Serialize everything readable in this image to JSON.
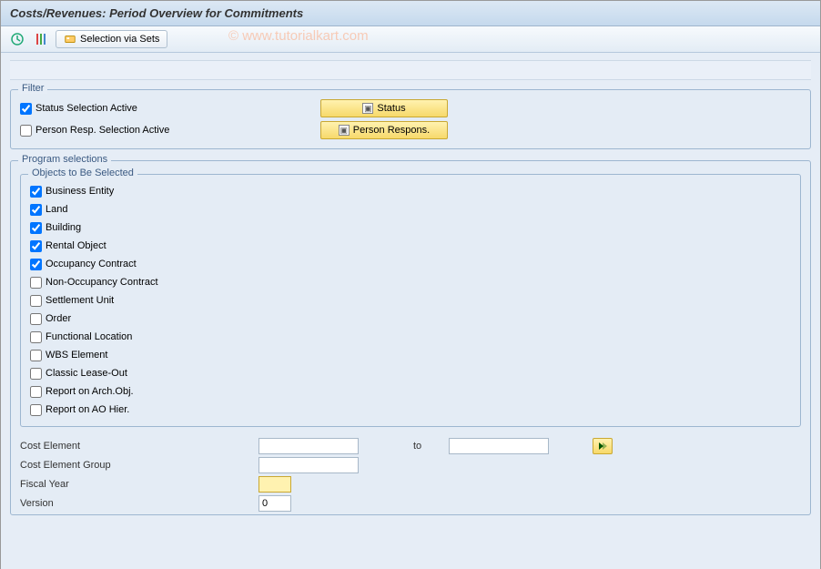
{
  "title": "Costs/Revenues: Period Overview for Commitments",
  "watermark": "© www.tutorialkart.com",
  "toolbar": {
    "selection_via_sets": "Selection via Sets"
  },
  "filter": {
    "group_label": "Filter",
    "status_active_label": "Status Selection Active",
    "status_active_checked": true,
    "status_button": "Status",
    "person_active_label": "Person Resp. Selection Active",
    "person_active_checked": false,
    "person_button": "Person Respons."
  },
  "program": {
    "group_label": "Program selections",
    "objects_label": "Objects to Be Selected",
    "objects": [
      {
        "label": "Business Entity",
        "checked": true
      },
      {
        "label": "Land",
        "checked": true
      },
      {
        "label": "Building",
        "checked": true
      },
      {
        "label": "Rental Object",
        "checked": true
      },
      {
        "label": "Occupancy Contract",
        "checked": true
      },
      {
        "label": "Non-Occupancy Contract",
        "checked": false
      },
      {
        "label": "Settlement Unit",
        "checked": false
      },
      {
        "label": "Order",
        "checked": false
      },
      {
        "label": "Functional Location",
        "checked": false
      },
      {
        "label": "WBS Element",
        "checked": false
      },
      {
        "label": "Classic Lease-Out",
        "checked": false
      },
      {
        "label": "Report on Arch.Obj.",
        "checked": false
      },
      {
        "label": "Report on AO Hier.",
        "checked": false
      }
    ],
    "cost_element_label": "Cost Element",
    "to_label": "to",
    "cost_element_from": "",
    "cost_element_to": "",
    "cost_element_group_label": "Cost Element Group",
    "cost_element_group_value": "",
    "fiscal_year_label": "Fiscal Year",
    "fiscal_year_value": "",
    "version_label": "Version",
    "version_value": "0"
  }
}
